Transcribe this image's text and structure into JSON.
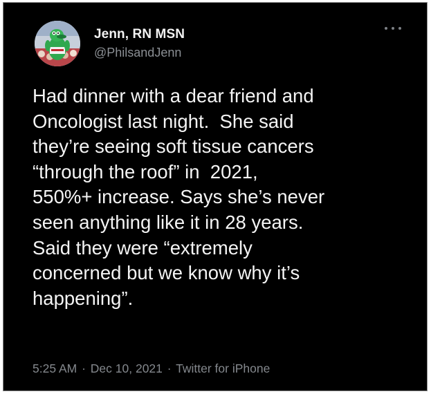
{
  "user": {
    "name": "Jenn, RN MSN",
    "handle": "@PhilsandJenn"
  },
  "tweet": {
    "lines": [
      "Had dinner with a dear friend and",
      "Oncologist last night.  She said",
      "they’re seeing soft tissue cancers",
      "“through the roof” in  2021,",
      "550%+ increase. Says she’s never",
      "seen anything like it in 28 years.",
      "Said they were “extremely",
      "concerned but we know why it’s",
      "happening”."
    ]
  },
  "meta": {
    "time": "5:25 AM",
    "date": "Dec 10, 2021",
    "source": "Twitter for iPhone",
    "separator": "·"
  },
  "icons": {
    "more": "more-options-icon",
    "avatar": "phanatic-mascot-avatar"
  },
  "colors": {
    "background": "#000000",
    "text": "#f4f4f4",
    "secondary_text": "#8b8f94"
  }
}
